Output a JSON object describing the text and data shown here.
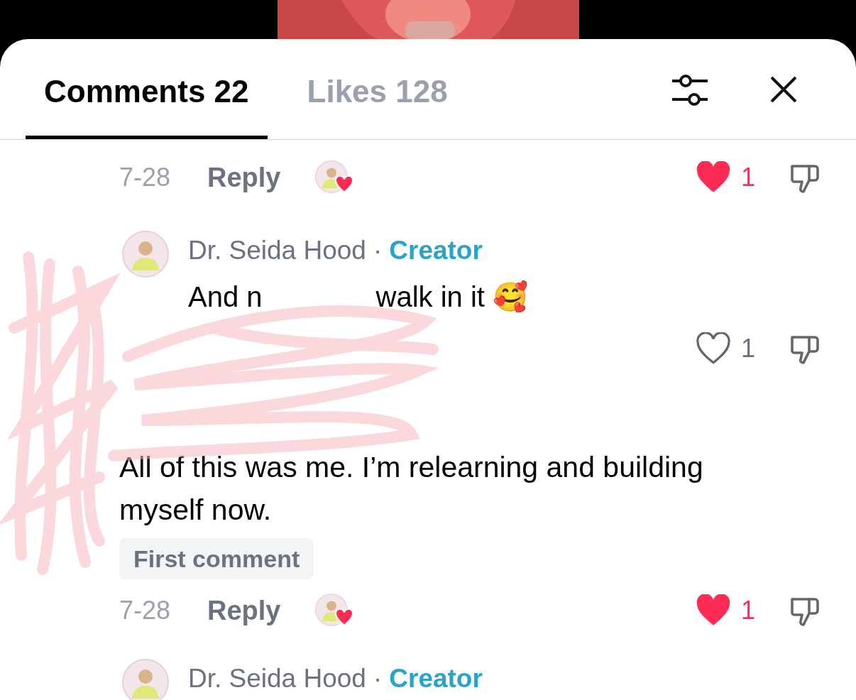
{
  "tabs": [
    {
      "label": "Comments 22",
      "selected": true
    },
    {
      "label": "Likes 128",
      "selected": false
    }
  ],
  "items": [
    {
      "kind": "actions",
      "date": "7-28",
      "reply": "Reply",
      "creator_liked": true,
      "liked": true,
      "likes": "1"
    },
    {
      "kind": "comment",
      "author": "Dr. Seida Hood",
      "separator": "·",
      "role": "Creator",
      "text": [
        "And n",
        "walk in it 🥰"
      ]
    },
    {
      "kind": "actions",
      "creator_liked": false,
      "liked": false,
      "likes": "1"
    },
    {
      "kind": "comment",
      "text": [
        "All of this was me. I’m relearning and building myself now."
      ],
      "tag": "First comment"
    },
    {
      "kind": "actions",
      "date": "7-28",
      "reply": "Reply",
      "creator_liked": true,
      "liked": true,
      "likes": "1"
    },
    {
      "kind": "comment",
      "author": "Dr. Seida Hood",
      "separator": "·",
      "role": "Creator"
    }
  ]
}
